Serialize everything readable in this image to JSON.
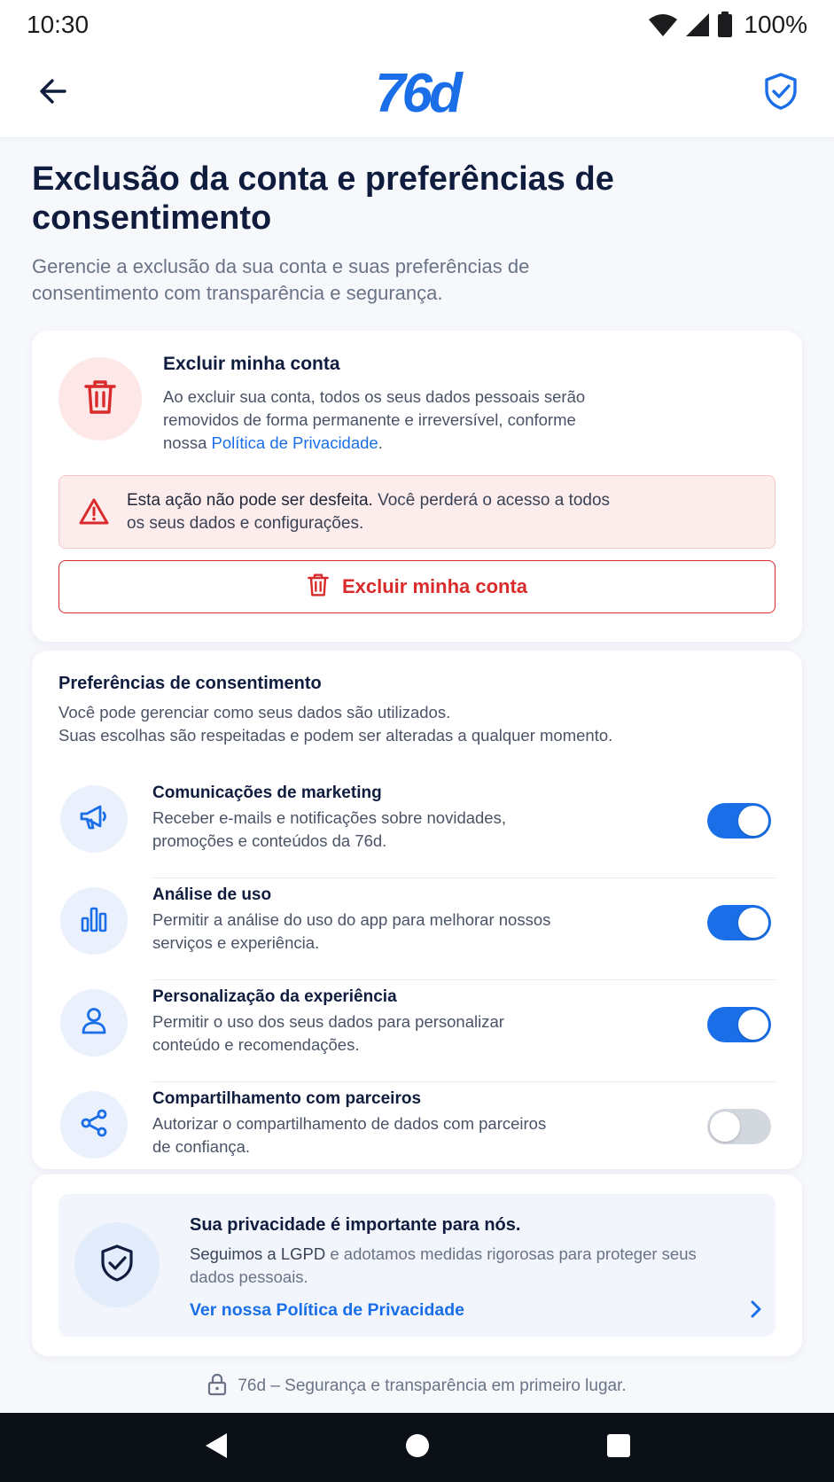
{
  "status_bar": {
    "time": "10:30",
    "battery": "100%",
    "icons": [
      "wifi-icon",
      "signal-icon",
      "battery-icon"
    ]
  },
  "app_bar": {
    "logo": "76d",
    "back_icon": "arrow-left-icon",
    "right_icon": "shield-check-icon",
    "accent_color": "#1a6fe8"
  },
  "header": {
    "title": "Exclusão da conta e preferências de consentimento",
    "subtitle": "Gerencie a exclusão da sua conta e suas preferências de consentimento com transparência e segurança."
  },
  "delete_card": {
    "icon": "trash-icon",
    "title": "Excluir minha conta",
    "description": "Ao excluir sua conta, todos os seus dados pessoais serão removidos de forma permanente e irreversível, conforme nossa ",
    "policy_link": "Política de Privacidade",
    "period": ".",
    "warning_icon": "warning-triangle-icon",
    "warning_strong": "Esta ação não pode ser desfeita.",
    "warning_text": " Você perderá o acesso a todos os seus dados e configurações.",
    "button_label": "Excluir minha conta",
    "danger_color": "#d92b2b"
  },
  "consent": {
    "title": "Preferências de consentimento",
    "description_line1": "Você pode gerenciar como seus dados são utilizados.",
    "description_line2": "Suas escolhas são respeitadas e podem ser alteradas a qualquer momento.",
    "items": [
      {
        "icon": "megaphone-icon",
        "title": "Comunicações de marketing",
        "description": "Receber e-mails e notificações sobre novidades, promoções e conteúdos da 76d.",
        "enabled": true
      },
      {
        "icon": "bar-chart-icon",
        "title": "Análise de uso",
        "description": "Permitir a análise do uso do app para melhorar nossos serviços e experiência.",
        "enabled": true
      },
      {
        "icon": "user-icon",
        "title": "Personalização da experiência",
        "description": "Permitir o uso dos seus dados para personalizar conteúdo e recomendações.",
        "enabled": true
      },
      {
        "icon": "share-icon",
        "title": "Compartilhamento com parceiros",
        "description": "Autorizar o compartilhamento de dados com parceiros de confiança.",
        "enabled": false
      }
    ]
  },
  "privacy": {
    "icon": "shield-check-icon",
    "title": "Sua privacidade é importante para nós.",
    "desc_strong": "Seguimos a LGPD",
    "desc_rest": " e adotamos medidas rigorosas para proteger seus dados pessoais.",
    "link": "Ver nossa Política de Privacidade",
    "chevron_icon": "chevron-right-icon"
  },
  "footer": {
    "icon": "lock-icon",
    "text": "76d – Segurança e transparência em primeiro lugar."
  },
  "nav_bar": {
    "buttons": [
      "back-triangle-icon",
      "home-circle-icon",
      "recents-square-icon"
    ]
  }
}
